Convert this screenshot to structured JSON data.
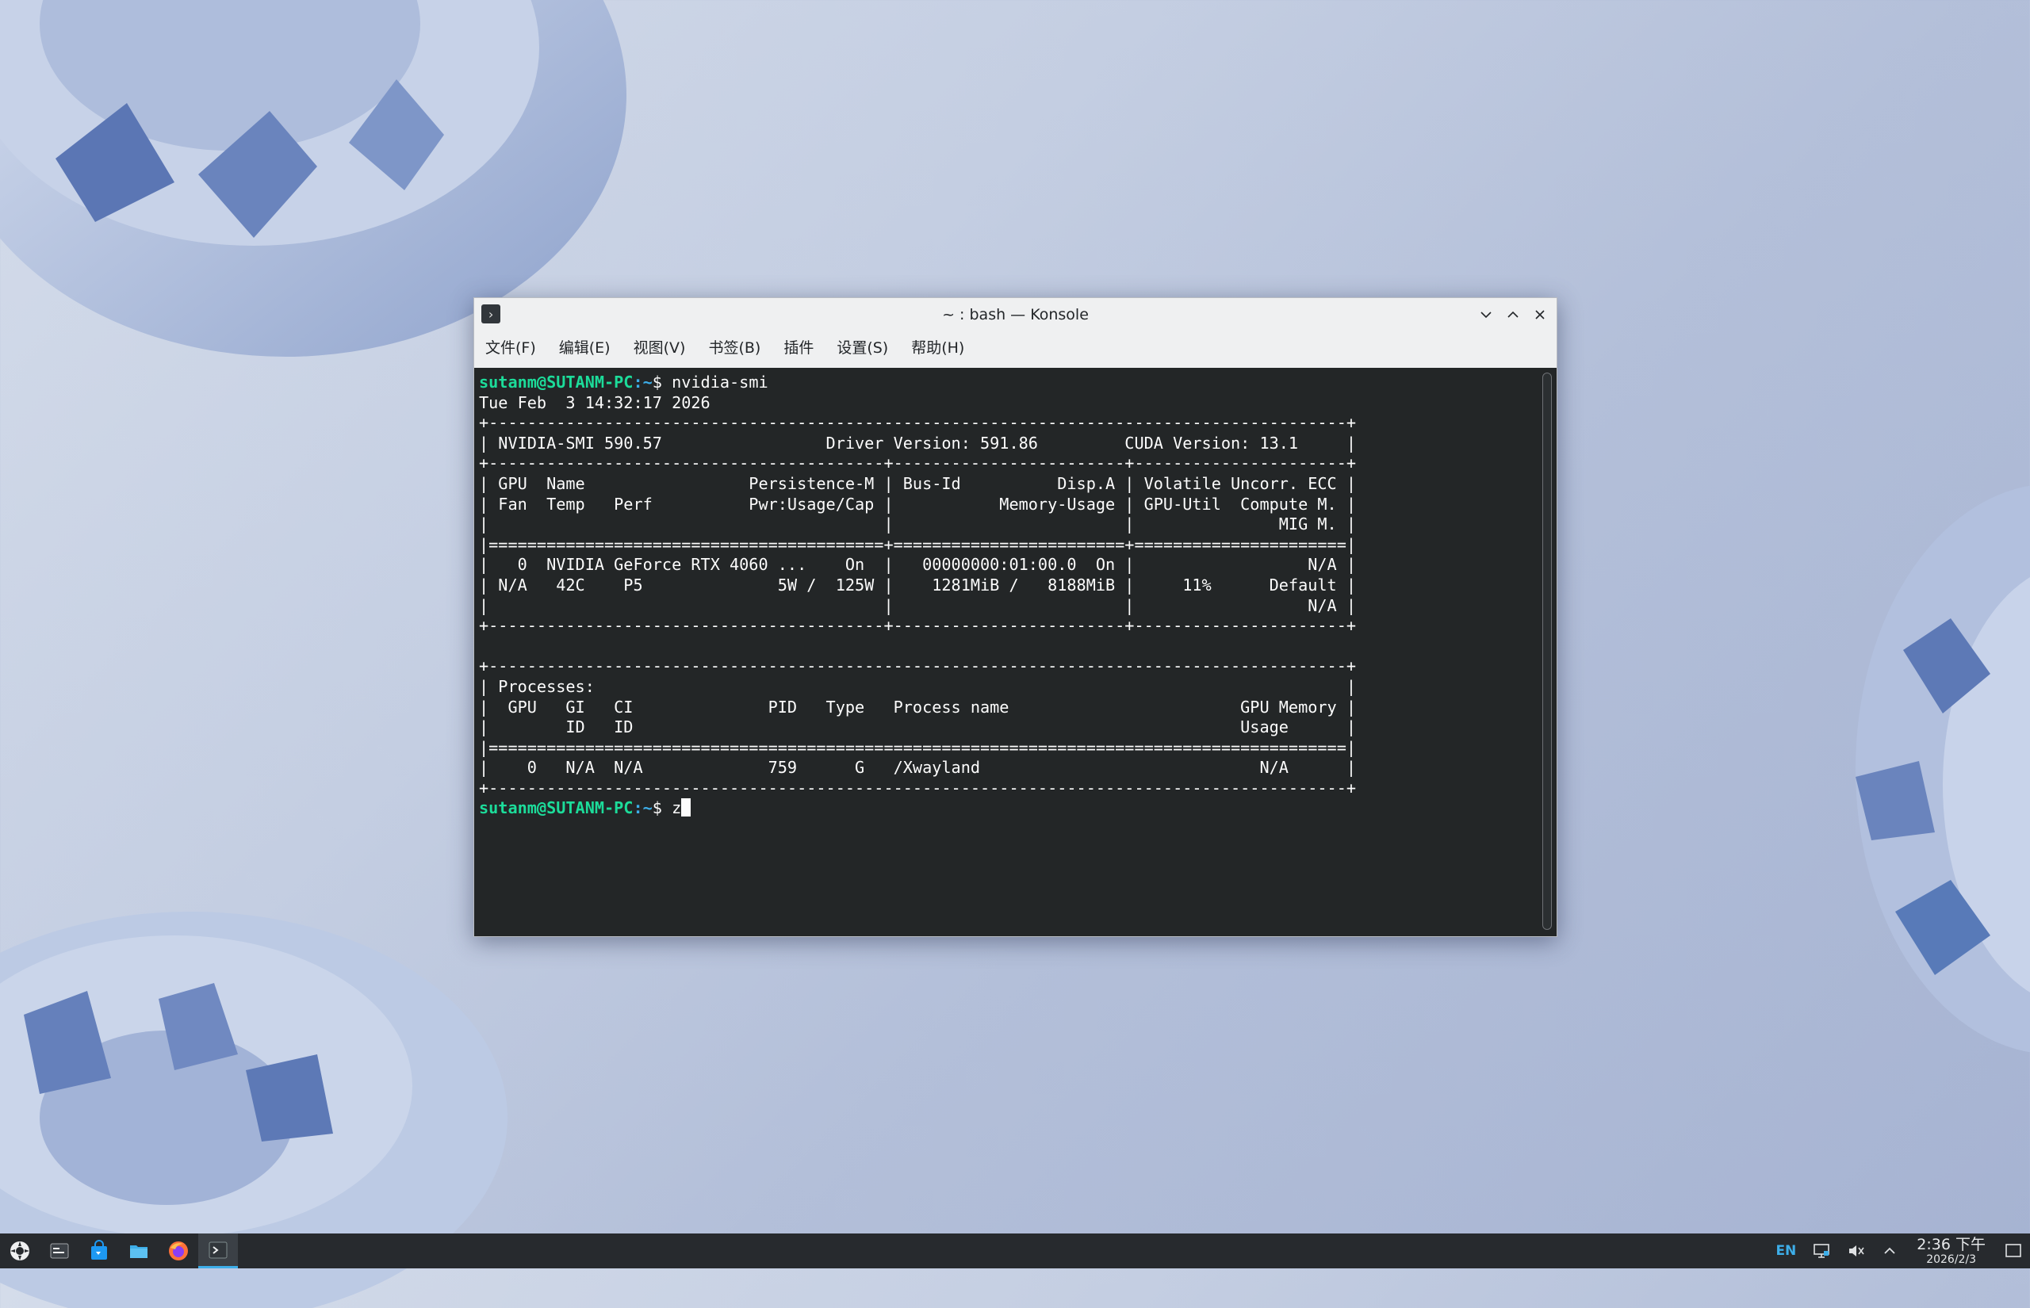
{
  "window": {
    "title": "~ : bash — Konsole",
    "menu": [
      "文件(F)",
      "编辑(E)",
      "视图(V)",
      "书签(B)",
      "插件",
      "设置(S)",
      "帮助(H)"
    ]
  },
  "terminal": {
    "prompt_user": "sutanm@SUTANM-PC",
    "prompt_path": ":~",
    "prompt_symbol": "$",
    "command": " nvidia-smi",
    "output": "Tue Feb  3 14:32:17 2026\n+-----------------------------------------------------------------------------------------+\n| NVIDIA-SMI 590.57                 Driver Version: 591.86         CUDA Version: 13.1     |\n+-----------------------------------------+------------------------+----------------------+\n| GPU  Name                 Persistence-M | Bus-Id          Disp.A | Volatile Uncorr. ECC |\n| Fan  Temp   Perf          Pwr:Usage/Cap |           Memory-Usage | GPU-Util  Compute M. |\n|                                         |                        |               MIG M. |\n|=========================================+========================+======================|\n|   0  NVIDIA GeForce RTX 4060 ...    On  |   00000000:01:00.0  On |                  N/A |\n| N/A   42C    P5              5W /  125W |    1281MiB /   8188MiB |     11%      Default |\n|                                         |                        |                  N/A |\n+-----------------------------------------+------------------------+----------------------+\n\n+-----------------------------------------------------------------------------------------+\n| Processes:                                                                              |\n|  GPU   GI   CI              PID   Type   Process name                        GPU Memory |\n|        ID   ID                                                               Usage      |\n|=========================================================================================|\n|    0   N/A  N/A             759      G   /Xwayland                             N/A      |\n+-----------------------------------------------------------------------------------------+",
    "current_input": " z"
  },
  "taskbar": {
    "apps": [
      {
        "name": "app-launcher",
        "icon": "kde-gear-icon"
      },
      {
        "name": "system-monitor",
        "icon": "system-monitor-icon"
      },
      {
        "name": "discover",
        "icon": "shopping-bag-icon"
      },
      {
        "name": "dolphin",
        "icon": "folder-icon"
      },
      {
        "name": "firefox",
        "icon": "firefox-icon"
      },
      {
        "name": "konsole",
        "icon": "terminal-icon",
        "active": true
      }
    ],
    "tray": {
      "lang": "EN",
      "clock_time": "2:36 下午",
      "clock_date": "2026/2/3"
    }
  },
  "colors": {
    "prompt_user": "#1cdc9a",
    "prompt_path": "#3daee9",
    "terminal_bg": "#232627",
    "accent": "#3daee9"
  }
}
